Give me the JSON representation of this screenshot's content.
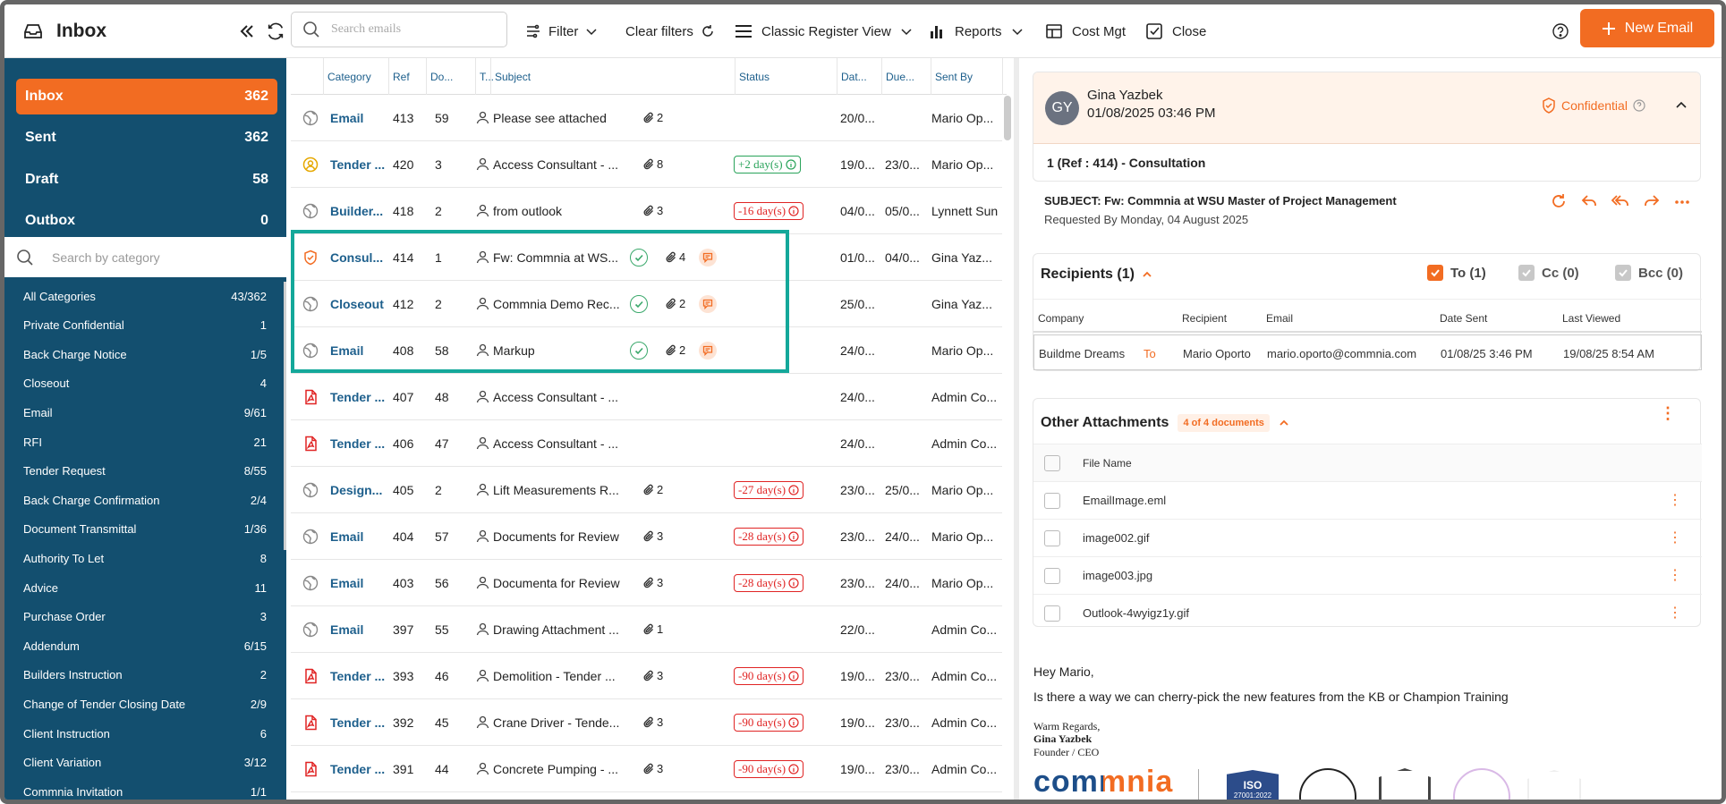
{
  "topbar": {
    "title": "Inbox",
    "search_placeholder": "Search emails",
    "filter_label": "Filter",
    "clear_filters_label": "Clear filters",
    "view_label": "Classic Register View",
    "reports_label": "Reports",
    "cost_label": "Cost Mgt",
    "close_label": "Close",
    "new_email_label": "New Email"
  },
  "folders": [
    {
      "label": "Inbox",
      "count": "362"
    },
    {
      "label": "Sent",
      "count": "362"
    },
    {
      "label": "Draft",
      "count": "58"
    },
    {
      "label": "Outbox",
      "count": "0"
    }
  ],
  "category_search_placeholder": "Search by category",
  "categories": [
    {
      "label": "All Categories",
      "count": "43/362"
    },
    {
      "label": "Private Confidential",
      "count": "1"
    },
    {
      "label": "Back Charge Notice",
      "count": "1/5"
    },
    {
      "label": "Closeout",
      "count": "4"
    },
    {
      "label": "Email",
      "count": "9/61"
    },
    {
      "label": "RFI",
      "count": "21"
    },
    {
      "label": "Tender Request",
      "count": "8/55"
    },
    {
      "label": "Back Charge Confirmation",
      "count": "2/4"
    },
    {
      "label": "Document Transmittal",
      "count": "1/36"
    },
    {
      "label": "Authority To Let",
      "count": "8"
    },
    {
      "label": "Advice",
      "count": "11"
    },
    {
      "label": "Purchase Order",
      "count": "3"
    },
    {
      "label": "Addendum",
      "count": "6/15"
    },
    {
      "label": "Builders Instruction",
      "count": "2"
    },
    {
      "label": "Change of Tender Closing Date",
      "count": "2/9"
    },
    {
      "label": "Client Instruction",
      "count": "6"
    },
    {
      "label": "Client Variation",
      "count": "3/12"
    },
    {
      "label": "Commnia Invitation",
      "count": "1/1"
    }
  ],
  "table": {
    "columns": [
      "Category",
      "Ref",
      "Do...",
      "T...",
      "Subject",
      "Status",
      "Dat...",
      "Due...",
      "Sent By"
    ],
    "rows": [
      {
        "icon": "globe",
        "category": "Email",
        "ref": "413",
        "doc": "59",
        "subject": "Please see attached",
        "attach": "2",
        "check": false,
        "comment": false,
        "status": "",
        "status_type": "",
        "date": "20/0...",
        "due": "",
        "sent_by": "Mario Op..."
      },
      {
        "icon": "user-circle",
        "category": "Tender ...",
        "ref": "420",
        "doc": "3",
        "subject": "Access Consultant - ...",
        "attach": "8",
        "check": false,
        "comment": false,
        "status": "+2 day(s)",
        "status_type": "pos",
        "date": "19/0...",
        "due": "23/0...",
        "sent_by": "Mario Op..."
      },
      {
        "icon": "globe",
        "category": "Builder...",
        "ref": "418",
        "doc": "2",
        "subject": "from outlook",
        "attach": "3",
        "check": false,
        "comment": false,
        "status": "-16 day(s)",
        "status_type": "neg",
        "date": "04/0...",
        "due": "05/0...",
        "sent_by": "Lynnett Sun"
      },
      {
        "icon": "shield",
        "category": "Consul...",
        "ref": "414",
        "doc": "1",
        "subject": "Fw: Commnia at WS...",
        "attach": "4",
        "check": true,
        "comment": true,
        "status": "",
        "status_type": "",
        "date": "01/0...",
        "due": "04/0...",
        "sent_by": "Gina Yaz..."
      },
      {
        "icon": "globe",
        "category": "Closeout",
        "ref": "412",
        "doc": "2",
        "subject": "Commnia Demo Rec...",
        "attach": "2",
        "check": true,
        "comment": true,
        "status": "",
        "status_type": "",
        "date": "25/0...",
        "due": "",
        "sent_by": "Gina Yaz..."
      },
      {
        "icon": "globe",
        "category": "Email",
        "ref": "408",
        "doc": "58",
        "subject": "Markup",
        "attach": "2",
        "check": true,
        "comment": true,
        "status": "",
        "status_type": "",
        "date": "24/0...",
        "due": "",
        "sent_by": "Mario Op..."
      },
      {
        "icon": "pdf",
        "category": "Tender ...",
        "ref": "407",
        "doc": "48",
        "subject": "Access Consultant - ...",
        "attach": "",
        "check": false,
        "comment": false,
        "status": "",
        "status_type": "",
        "date": "24/0...",
        "due": "",
        "sent_by": "Admin Co..."
      },
      {
        "icon": "pdf",
        "category": "Tender ...",
        "ref": "406",
        "doc": "47",
        "subject": "Access Consultant - ...",
        "attach": "",
        "check": false,
        "comment": false,
        "status": "",
        "status_type": "",
        "date": "24/0...",
        "due": "",
        "sent_by": "Admin Co..."
      },
      {
        "icon": "globe",
        "category": "Design...",
        "ref": "405",
        "doc": "2",
        "subject": "Lift Measurements R...",
        "attach": "2",
        "check": false,
        "comment": false,
        "status": "-27 day(s)",
        "status_type": "neg",
        "date": "23/0...",
        "due": "25/0...",
        "sent_by": "Mario Op..."
      },
      {
        "icon": "globe",
        "category": "Email",
        "ref": "404",
        "doc": "57",
        "subject": "Documents for Review",
        "attach": "3",
        "check": false,
        "comment": false,
        "status": "-28 day(s)",
        "status_type": "neg",
        "date": "23/0...",
        "due": "24/0...",
        "sent_by": "Mario Op..."
      },
      {
        "icon": "globe",
        "category": "Email",
        "ref": "403",
        "doc": "56",
        "subject": "Documenta for Review",
        "attach": "3",
        "check": false,
        "comment": false,
        "status": "-28 day(s)",
        "status_type": "neg",
        "date": "23/0...",
        "due": "24/0...",
        "sent_by": "Mario Op..."
      },
      {
        "icon": "globe",
        "category": "Email",
        "ref": "397",
        "doc": "55",
        "subject": "Drawing Attachment ...",
        "attach": "1",
        "check": false,
        "comment": false,
        "status": "",
        "status_type": "",
        "date": "22/0...",
        "due": "",
        "sent_by": "Admin Co..."
      },
      {
        "icon": "pdf",
        "category": "Tender ...",
        "ref": "393",
        "doc": "46",
        "subject": "Demolition - Tender ...",
        "attach": "3",
        "check": false,
        "comment": false,
        "status": "-90 day(s)",
        "status_type": "neg",
        "date": "19/0...",
        "due": "23/0...",
        "sent_by": "Admin Co..."
      },
      {
        "icon": "pdf",
        "category": "Tender ...",
        "ref": "392",
        "doc": "45",
        "subject": "Crane Driver - Tende...",
        "attach": "3",
        "check": false,
        "comment": false,
        "status": "-90 day(s)",
        "status_type": "neg",
        "date": "19/0...",
        "due": "23/0...",
        "sent_by": "Admin Co..."
      },
      {
        "icon": "pdf",
        "category": "Tender ...",
        "ref": "391",
        "doc": "44",
        "subject": "Concrete Pumping - ...",
        "attach": "3",
        "check": false,
        "comment": false,
        "status": "-90 day(s)",
        "status_type": "neg",
        "date": "19/0...",
        "due": "23/0...",
        "sent_by": "Admin Co..."
      }
    ]
  },
  "detail": {
    "sender_initials": "GY",
    "sender_name": "Gina Yazbek",
    "sent_datetime": "01/08/2025 03:46 PM",
    "confidential_label": "Confidential",
    "ref_line": "1 (Ref : 414) - Consultation",
    "subject_line": "SUBJECT: Fw: Commnia at WSU Master of Project Management",
    "requested_by": "Requested By Monday, 04 August 2025",
    "recipients_title": "Recipients (1)",
    "to_label": "To (1)",
    "cc_label": "Cc (0)",
    "bcc_label": "Bcc (0)",
    "recipient_columns": [
      "Company",
      "Recipient",
      "Email",
      "Date Sent",
      "Last Viewed"
    ],
    "recipient_row": {
      "company": "Buildme Dreams",
      "type": "To",
      "recipient": "Mario Oporto",
      "email": "mario.oporto@commnia.com",
      "date_sent": "01/08/25 3:46 PM",
      "last_viewed": "19/08/25 8:54 AM"
    },
    "attachments_title": "Other Attachments",
    "attachments_badge": "4 of 4 documents",
    "file_name_header": "File Name",
    "files": [
      "EmailImage.eml",
      "image002.gif",
      "image003.jpg",
      "Outlook-4wyigz1y.gif"
    ],
    "greeting": "Hey Mario,",
    "body": "Is there a way we can cherry-pick the new features from the KB or Champion Training",
    "signoff": "Warm Regards,",
    "sig_name": "Gina Yazbek",
    "sig_title": "Founder / CEO",
    "logo_text": "commnia",
    "badge_iso_top": "ISO",
    "badge_iso_bottom": "27001:2022"
  },
  "colors": {
    "accent": "#f26c22",
    "sidebar": "#134f6f",
    "link": "#1d5f8c",
    "teal": "#14a89a",
    "negative": "#e02424",
    "positive": "#29a35a"
  }
}
